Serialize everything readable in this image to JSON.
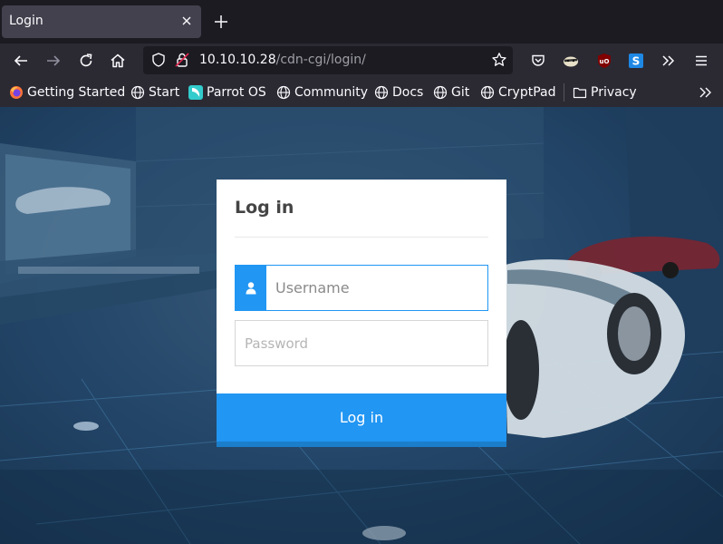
{
  "tab": {
    "title": "Login"
  },
  "urlbar": {
    "host": "10.10.10.28",
    "path": "/cdn-cgi/login/"
  },
  "bookmarks": [
    {
      "label": "Getting Started",
      "icon": "firefox-icon"
    },
    {
      "label": "Start",
      "icon": "globe-icon"
    },
    {
      "label": "Parrot OS",
      "icon": "parrot-icon"
    },
    {
      "label": "Community",
      "icon": "globe-icon"
    },
    {
      "label": "Docs",
      "icon": "globe-icon"
    },
    {
      "label": "Git",
      "icon": "globe-icon"
    },
    {
      "label": "CryptPad",
      "icon": "globe-icon"
    },
    {
      "label": "Privacy",
      "icon": "folder-icon"
    }
  ],
  "login": {
    "title": "Log in",
    "username_placeholder": "Username",
    "password_placeholder": "Password",
    "submit_label": "Log in"
  },
  "colors": {
    "accent": "#2196f3",
    "accent_dark": "#1b7ecb",
    "chrome_dark": "#1c1b22",
    "chrome": "#2b2a33"
  }
}
